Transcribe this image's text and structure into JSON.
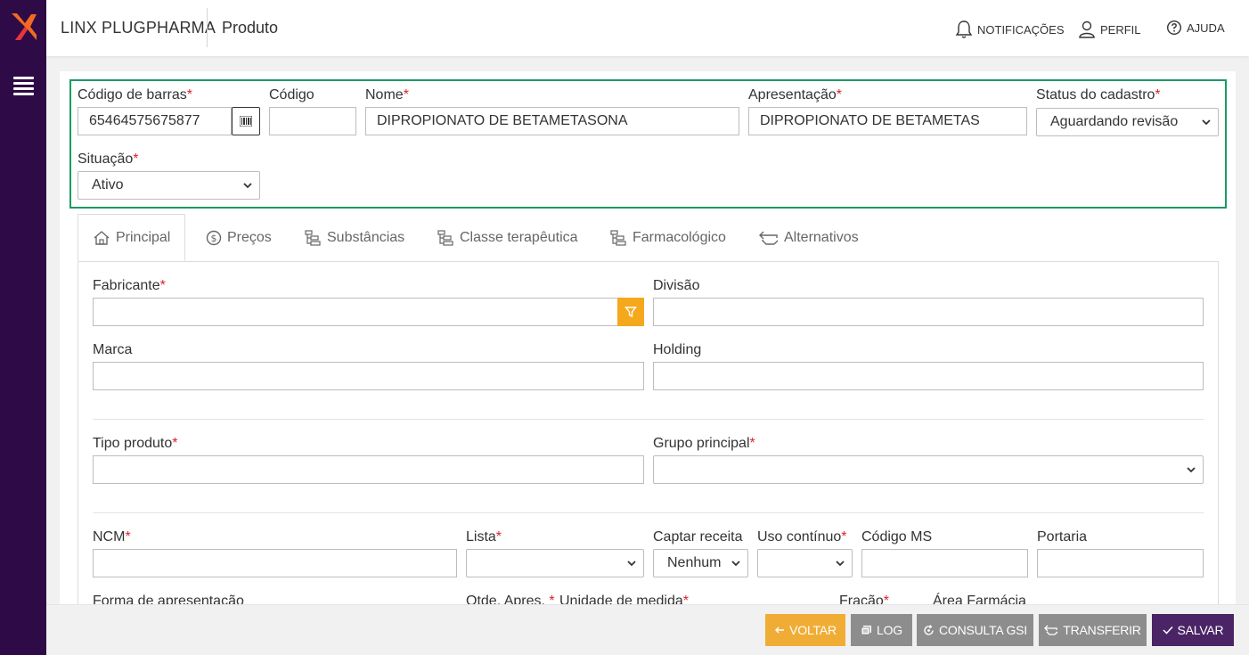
{
  "app": {
    "brand": "LINX PLUGPHARMA",
    "page_title": "Produto",
    "top_actions": {
      "notifications": "NOTIFICAÇÕES",
      "profile": "PERFIL",
      "help": "AJUDA"
    }
  },
  "header_form": {
    "barcode": {
      "label": "Código de barras",
      "required": "*",
      "value": "65464575675877"
    },
    "code": {
      "label": "Código",
      "value": ""
    },
    "name": {
      "label": "Nome",
      "required": "*",
      "value": "DIPROPIONATO DE BETAMETASONA"
    },
    "presentation": {
      "label": "Apresentação",
      "required": "*",
      "value": "DIPROPIONATO DE BETAMETAS"
    },
    "status": {
      "label": "Status do cadastro",
      "required": "*",
      "value": "Aguardando revisão"
    },
    "situation": {
      "label": "Situação",
      "required": "*",
      "value": "Ativo"
    }
  },
  "tabs": [
    {
      "label": "Principal",
      "icon": "home-icon",
      "active": true
    },
    {
      "label": "Preços",
      "icon": "dollar-icon"
    },
    {
      "label": "Substâncias",
      "icon": "tree-icon"
    },
    {
      "label": "Classe terapêutica",
      "icon": "tree-icon"
    },
    {
      "label": "Farmacológico",
      "icon": "tree-icon"
    },
    {
      "label": "Alternativos",
      "icon": "swap-icon"
    }
  ],
  "principal": {
    "manufacturer": {
      "label": "Fabricante",
      "required": "*",
      "value": ""
    },
    "division": {
      "label": "Divisão",
      "value": ""
    },
    "brand": {
      "label": "Marca",
      "value": ""
    },
    "holding": {
      "label": "Holding",
      "value": ""
    },
    "product_type": {
      "label": "Tipo produto",
      "required": "*",
      "value": ""
    },
    "main_group": {
      "label": "Grupo principal",
      "required": "*",
      "value": ""
    },
    "ncm": {
      "label": "NCM",
      "required": "*",
      "value": ""
    },
    "list": {
      "label": "Lista",
      "required": "*",
      "value": ""
    },
    "capture_prescription": {
      "label": "Captar receita",
      "value": "Nenhum"
    },
    "continuous_use": {
      "label": "Uso contínuo",
      "required": "*",
      "value": ""
    },
    "ms_code": {
      "label": "Código MS",
      "value": ""
    },
    "ordinance": {
      "label": "Portaria",
      "value": ""
    },
    "presentation_form": {
      "label": "Forma de apresentação"
    },
    "qty_presentation": {
      "label": "Qtde. Apres.",
      "required": "*"
    },
    "unit_measure": {
      "label": "Unidade de medida",
      "required": "*"
    },
    "fraction": {
      "label": "Fração",
      "required": "*"
    },
    "pharmacy_area": {
      "label": "Área Farmácia"
    }
  },
  "footer": {
    "back": "VOLTAR",
    "log": "LOG",
    "gsi": "CONSULTA GSI",
    "transfer": "TRANSFERIR",
    "save": "SALVAR"
  },
  "colors": {
    "sidebar": "#2e0b46",
    "highlight_border": "#1a9a63",
    "required": "#d9232d",
    "filter_button": "#f5a81c",
    "back_button": "#f0ad36",
    "grey_button": "#8d8d8d",
    "save_button": "#4b2466"
  }
}
